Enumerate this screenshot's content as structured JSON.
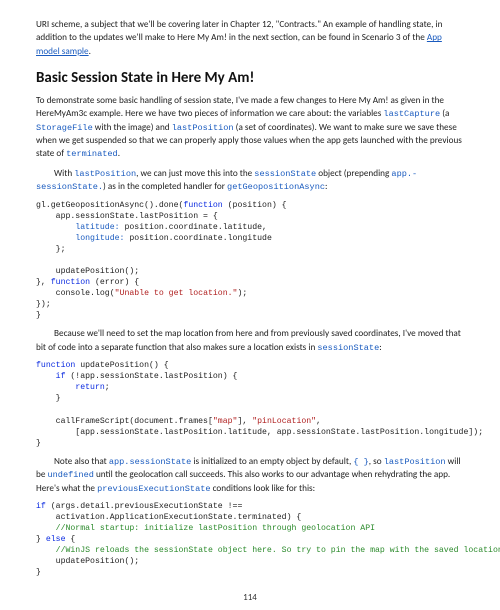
{
  "intro": {
    "p1a": "URI scheme, a subject that we'll be covering later in Chapter 12, \"Contracts.\" An example of handling state, in addition to the updates we'll make to Here My Am! in the next section, can be found in Scenario 3 of the ",
    "p1_link": "App model sample",
    "p1b": "."
  },
  "heading": "Basic Session State in Here My Am!",
  "body": {
    "p2a": "To demonstrate some basic handling of session state, I've made a few changes to Here My Am! as given in the HereMyAm3c example. Here we have two pieces of information we care about: the variables ",
    "p2_code1": "lastCapture",
    "p2b": " (a ",
    "p2_code2": "StorageFile",
    "p2c": " with the image) and ",
    "p2_code3": "lastPosition",
    "p2d": " (a set of coordinates). We want to make sure we save these when we get suspended so that we can properly apply those values when the app gets launched with the previous state of ",
    "p2_code4": "terminated",
    "p2e": ".",
    "p3a": "With ",
    "p3_code1": "lastPosition",
    "p3b": ", we can just move this into the ",
    "p3_code2": "sessionState",
    "p3c": " object (prepending ",
    "p3_code3": "app.-",
    "p3_code3b": "sessionState.",
    "p3d": ") as in the completed handler for ",
    "p3_code4": "getGeopositionAsync",
    "p3e": ":",
    "p4": "Because we'll need to set the map location from here and from previously saved coordinates, I've moved that bit of code into a separate function that also makes sure a location exists in ",
    "p4_code1": "sessionState",
    "p4b": ":",
    "p5a": "Note also that ",
    "p5_code1": "app.sessionState",
    "p5b": " is initialized to an empty object by default, ",
    "p5_code2": "{ }",
    "p5c": ", so ",
    "p5_code3": "lastPosition",
    "p5d": " will be ",
    "p5_code4": "undefined",
    "p5e": " until the geolocation call succeeds. This also works to our advantage when rehydrating the app. Here's what the ",
    "p5_code5": "previousExecutionState",
    "p5f": " conditions look like for this:"
  },
  "code1": {
    "l1a": "gl.getGeopositionAsync().done(",
    "l1_kw": "function",
    "l1b": " (position) {",
    "l2": "    app.sessionState.lastPosition = {",
    "l3a": "        ",
    "l3b": "latitude:",
    "l3c": " position.coordinate.latitude,",
    "l4a": "        ",
    "l4b": "longitude:",
    "l4c": " position.coordinate.longitude",
    "l5": "    };",
    "blank": "",
    "l6": "    updatePosition();",
    "l7a": "}, ",
    "l7_kw": "function",
    "l7b": " (error) {",
    "l8a": "    console.log(",
    "l8_str": "\"Unable to get location.\"",
    "l8b": ");",
    "l9": "});",
    "l10": "}"
  },
  "code2": {
    "l1_kw": "function",
    "l1a": " updatePosition() {",
    "l2a": "    ",
    "l2_kw": "if",
    "l2b": " (!app.sessionState.lastPosition) {",
    "l3a": "        ",
    "l3_kw": "return",
    "l3b": ";",
    "l4": "    }",
    "blank": "",
    "l5a": "    callFrameScript(document.frames[",
    "l5_str1": "\"map\"",
    "l5b": "], ",
    "l5_str2": "\"pinLocation\"",
    "l5c": ",",
    "l6": "        [app.sessionState.lastPosition.latitude, app.sessionState.lastPosition.longitude]);",
    "l7": "}"
  },
  "code3": {
    "l1_kw": "if",
    "l1a": " (args.detail.previousExecutionState !==",
    "l2": "    activation.ApplicationExecutionState.terminated) {",
    "l3a": "    ",
    "l3_cmt": "//Normal startup: initialize lastPosition through geolocation API",
    "l4a": "} ",
    "l4_kw": "else",
    "l4b": " {",
    "l5a": "    ",
    "l5_cmt": "//WinJS reloads the sessionState object here. So try to pin the map with the saved location",
    "l6": "    updatePosition();",
    "l7": "}"
  },
  "page_number": "114"
}
